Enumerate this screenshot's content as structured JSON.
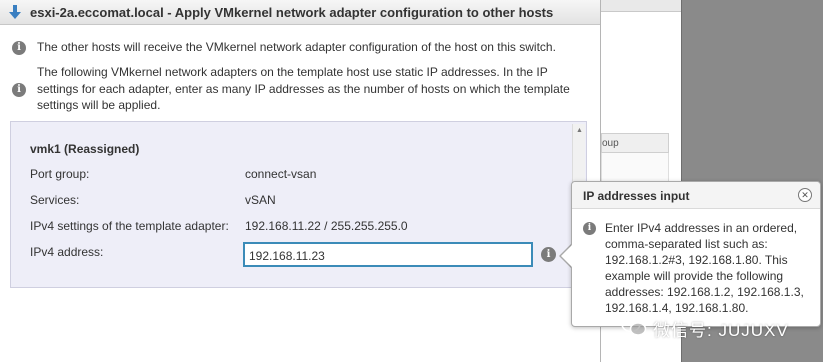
{
  "dialog": {
    "title": "esxi-2a.eccomat.local - Apply VMkernel network adapter configuration to other hosts",
    "info1": "The other hosts will receive the VMkernel network adapter configuration of the host on this switch.",
    "info2_lines": [
      "The following VMkernel network adapters on the template host use static IP addresses. In the IP",
      "settings for each adapter, enter as many IP addresses as the number of hosts on which the template",
      "settings will be applied."
    ]
  },
  "adapter": {
    "heading": "vmk1 (Reassigned)",
    "port_group_label": "Port group:",
    "port_group_value": "connect-vsan",
    "services_label": "Services:",
    "services_value": "vSAN",
    "ipv4_settings_label": "IPv4 settings of the template adapter:",
    "ipv4_settings_value": "192.168.11.22 / 255.255.255.0",
    "ipv4_address_label": "IPv4 address:",
    "ipv4_address_value": "192.168.11.23"
  },
  "popover": {
    "title": "IP addresses input",
    "lines": [
      "Enter IPv4 addresses in an ordered,",
      "comma-separated list such as:",
      "192.168.1.2#3, 192.168.1.80. This",
      "example will provide the following",
      "addresses: 192.168.1.2, 192.168.1.3,",
      "192.168.1.4, 192.168.1.80."
    ]
  },
  "background": {
    "column_header_fragment": "oup"
  },
  "watermark": {
    "text": "微信号: JUJUXV"
  },
  "icons": {
    "title": "download-arrow-icon",
    "info": "info-icon",
    "close": "close-icon"
  },
  "colors": {
    "input_border": "#3b8bb8",
    "adapter_bg": "#eeeef8",
    "title_arrow": "#3a7fc1"
  }
}
